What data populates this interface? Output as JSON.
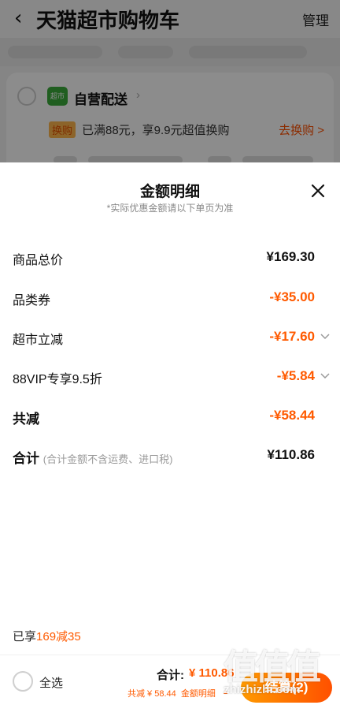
{
  "background": {
    "back_icon": "chevron-left-icon",
    "title": "天猫超市购物车",
    "manage_label": "管理",
    "store": {
      "badge_text": "超市",
      "name": "自营配送"
    },
    "exchange": {
      "badge": "换购",
      "text": "已满88元，享9.9元超值换购",
      "link": "去换购 >"
    }
  },
  "sheet": {
    "title": "金额明细",
    "subtitle": "*实际优惠金额请以下单页为准",
    "close_icon": "close-icon",
    "rows": [
      {
        "label": "商品总价",
        "value": "¥169.30"
      },
      {
        "label": "品类券",
        "value": "-¥35.00"
      },
      {
        "label": "超市立减",
        "value": "-¥17.60"
      },
      {
        "label": "88VIP专享9.5折",
        "value": "-¥5.84"
      },
      {
        "label": "共减",
        "value": "-¥58.44"
      },
      {
        "label": "合计",
        "note": "(合计金额不含运费、进口税)",
        "value": "¥110.86"
      }
    ],
    "already": {
      "prefix": "已享",
      "promo": "169减35"
    }
  },
  "bottom_bar": {
    "select_all": "全选",
    "total_label": "合计:",
    "total_value": "¥ 110.86",
    "saved": "共减 ¥ 58.44",
    "detail_link": "金额明细",
    "checkout": "结算(2)"
  },
  "watermark": {
    "logo": "值值值",
    "url": "zhizhizhi.com"
  },
  "colors": {
    "accent": "#ff5a00",
    "overlay": "rgba(0,0,0,0.45)"
  }
}
